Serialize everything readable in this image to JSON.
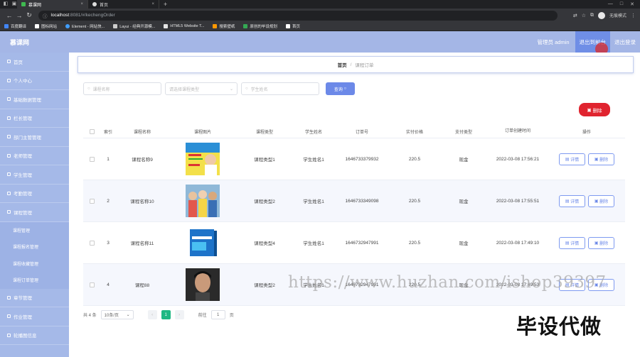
{
  "browser": {
    "tabs": [
      {
        "label": "慕课网",
        "active": true
      },
      {
        "label": "首页",
        "active": false
      }
    ],
    "url_host": "localhost",
    "url_path": ":8081/#/kechengOrder",
    "profile_label": "无痕模式",
    "bookmarks": [
      "百度翻译",
      "图标网站",
      "Element - 网站快...",
      "Layui - 经典开源模...",
      "HTML5 Website T...",
      "搜索壁纸",
      "原创的毕设规划",
      "首页"
    ]
  },
  "header": {
    "logo": "慕课网",
    "user": "管理员 admin",
    "front_btn": "退出到前台",
    "logout_btn": "退出登录"
  },
  "sidebar": {
    "items": [
      "首页",
      "个人中心",
      "基础数据管理",
      "栏长管理",
      "部门主管管理",
      "老师管理",
      "学生管理",
      "考勤管理",
      "课程管理"
    ],
    "subitems": [
      "课程管理",
      "课程报名管理",
      "课程收藏管理",
      "课程订单管理"
    ],
    "items_after": [
      "章节管理",
      "作业管理",
      "轮播图信息"
    ]
  },
  "breadcrumb": {
    "home": "首页",
    "separator": "/",
    "current": "课程订单"
  },
  "search": {
    "course_name_placeholder": "课程名称",
    "course_type_placeholder": "请选择课程类型",
    "student_name_placeholder": "学生姓名",
    "search_btn": "查询"
  },
  "delete_btn": "删除",
  "table": {
    "headers": [
      "索引",
      "课程名称",
      "课程图片",
      "课程类型",
      "学生姓名",
      "订单号",
      "实付价格",
      "支付类型",
      "订单创建时间",
      "操作"
    ],
    "rows": [
      {
        "idx": "1",
        "name": "课程名称9",
        "type": "课程类型1",
        "student": "学生姓名1",
        "order": "1646733379932",
        "price": "220.5",
        "pay": "现金",
        "time": "2022-03-08 17:56:21"
      },
      {
        "idx": "2",
        "name": "课程名称10",
        "type": "课程类型2",
        "student": "学生姓名1",
        "order": "1646733349098",
        "price": "220.5",
        "pay": "现金",
        "time": "2022-03-08 17:55:51"
      },
      {
        "idx": "3",
        "name": "课程名称11",
        "type": "课程类型4",
        "student": "学生姓名1",
        "order": "1646732947991",
        "price": "220.5",
        "pay": "现金",
        "time": "2022-03-08 17:49:10"
      },
      {
        "idx": "4",
        "name": "课程88",
        "type": "课程类型2",
        "student": "学生姓名1",
        "order": "1646732947991",
        "price": "220.5",
        "pay": "现金",
        "time": "2022-03-08 17:49:53"
      }
    ],
    "detail_btn": "详情",
    "row_delete_btn": "删除"
  },
  "pager": {
    "total": "共 4 条",
    "page_size": "10条/页",
    "current_page": "1",
    "goto_label": "前往",
    "goto_value": "1",
    "page_unit": "页"
  },
  "watermark": "https://www.huzhan.com/ishop39397",
  "corner_text": "毕设代做"
}
